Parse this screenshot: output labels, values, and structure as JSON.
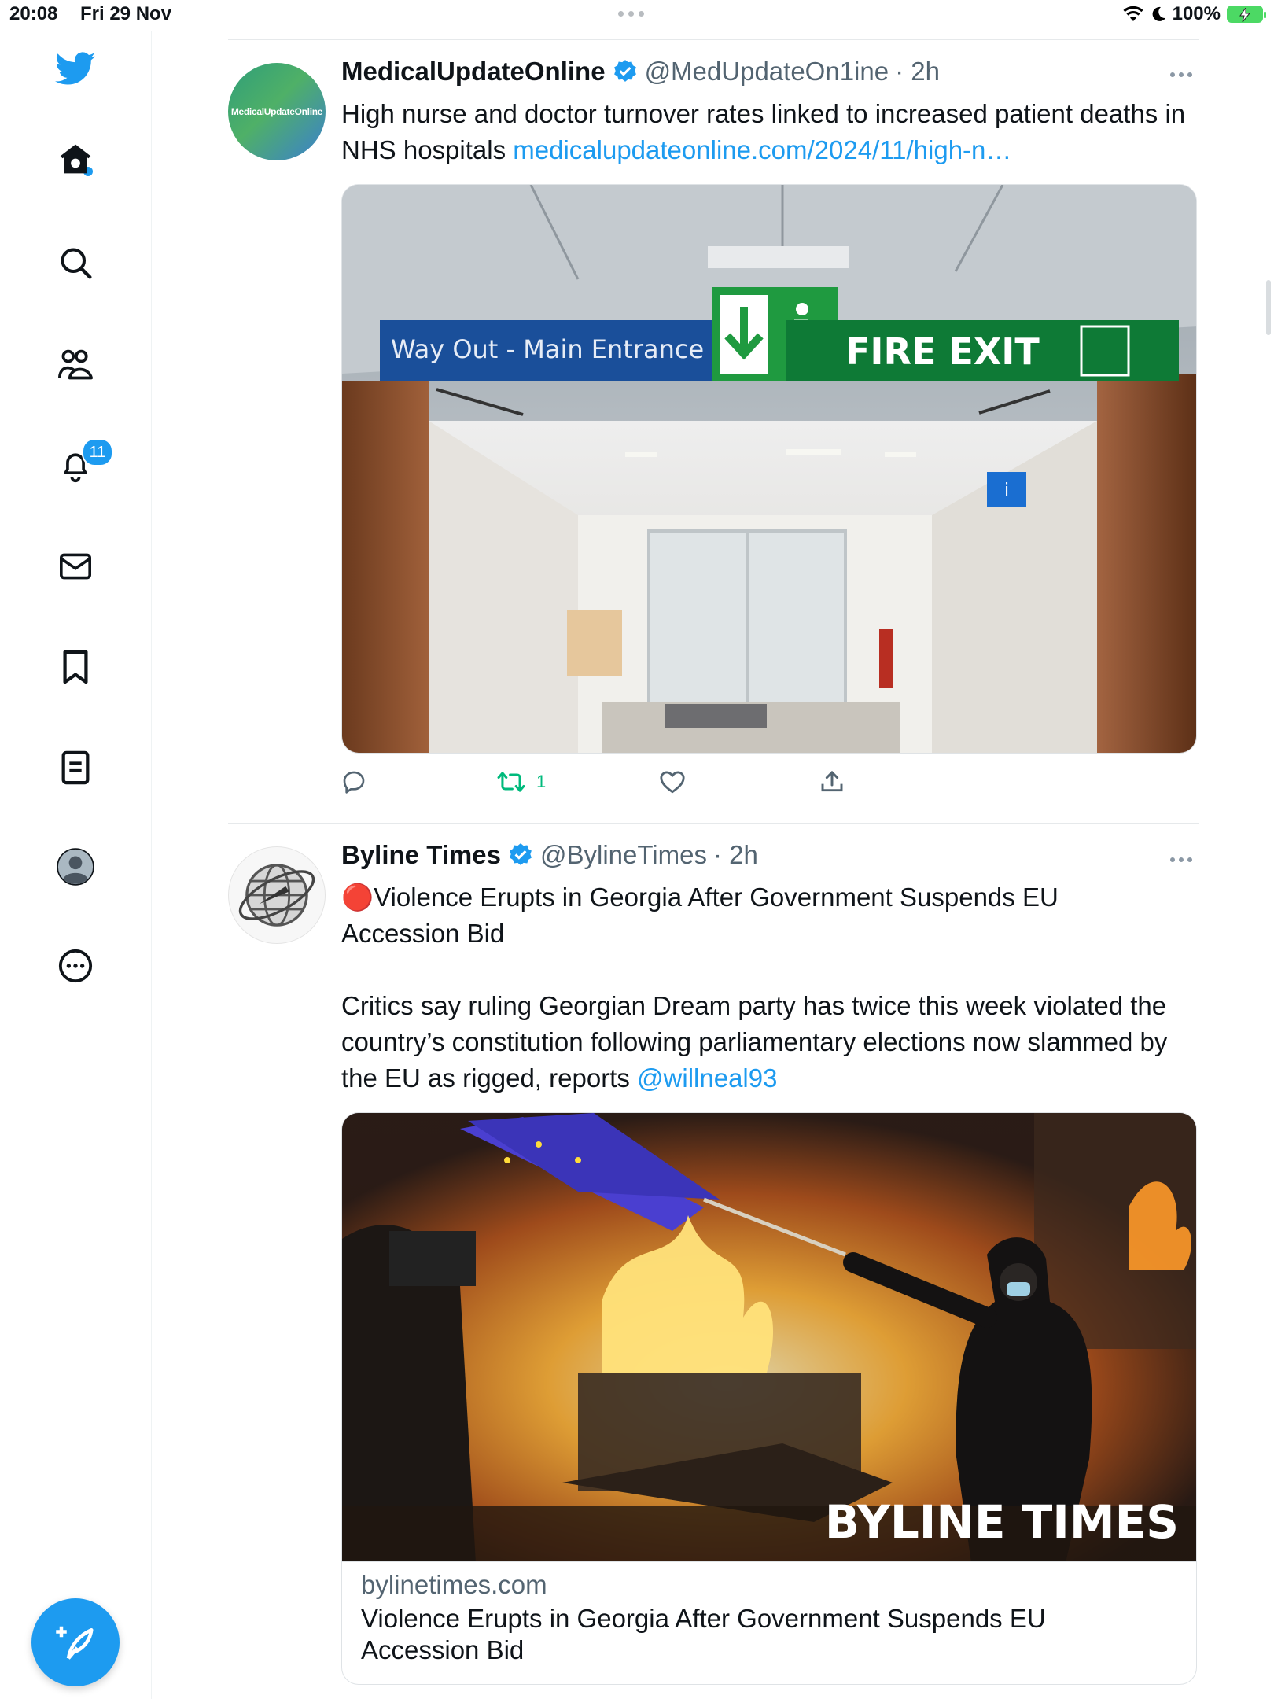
{
  "status_bar": {
    "time": "20:08",
    "date": "Fri 29 Nov",
    "battery": "100%"
  },
  "sidebar": {
    "items": [
      {
        "name": "home",
        "icon": "home-icon"
      },
      {
        "name": "explore",
        "icon": "search-icon"
      },
      {
        "name": "communities",
        "icon": "people-icon"
      },
      {
        "name": "notifications",
        "icon": "bell-icon",
        "badge": "11"
      },
      {
        "name": "messages",
        "icon": "mail-icon"
      },
      {
        "name": "bookmarks",
        "icon": "bookmark-icon"
      },
      {
        "name": "lists",
        "icon": "list-icon"
      },
      {
        "name": "profile",
        "icon": "avatar-icon"
      },
      {
        "name": "more",
        "icon": "more-circle-icon"
      }
    ],
    "logo_icon": "twitter-bird-icon",
    "compose_icon": "compose-feather-icon"
  },
  "tweets": [
    {
      "author": "MedicalUpdateOnline",
      "handle": "@MedUpdateOn1ine",
      "time": "· 2h",
      "avatar_text": "MedicalUpdateOnline",
      "text": "High nurse and doctor turnover rates linked to increased patient deaths in NHS hospitals ",
      "link": "medicalupdateonline.com/2024/11/high-n…",
      "image_signs": {
        "way_out": "Way Out - Main Entrance",
        "fire_exit": "FIRE EXIT",
        "info": "Information"
      },
      "retweet_count": "1"
    },
    {
      "author": "Byline Times",
      "handle": "@BylineTimes",
      "time": "· 2h",
      "text_line1": "🔴Violence Erupts in Georgia After Government Suspends EU Accession Bid",
      "text_line2": "Critics say ruling Georgian Dream party has twice this week violated the country’s constitution following parliamentary elections now slammed by the EU as rigged, reports ",
      "mention": "@willneal93",
      "image_watermark": "BYLINE TIMES",
      "card_domain": "bylinetimes.com",
      "card_title": "Violence Erupts in Georgia After Government Suspends EU Accession Bid"
    }
  ],
  "colors": {
    "accent": "#1d9bf0",
    "retweet": "#00ba7c",
    "text": "#0f1419",
    "muted": "#536471"
  }
}
